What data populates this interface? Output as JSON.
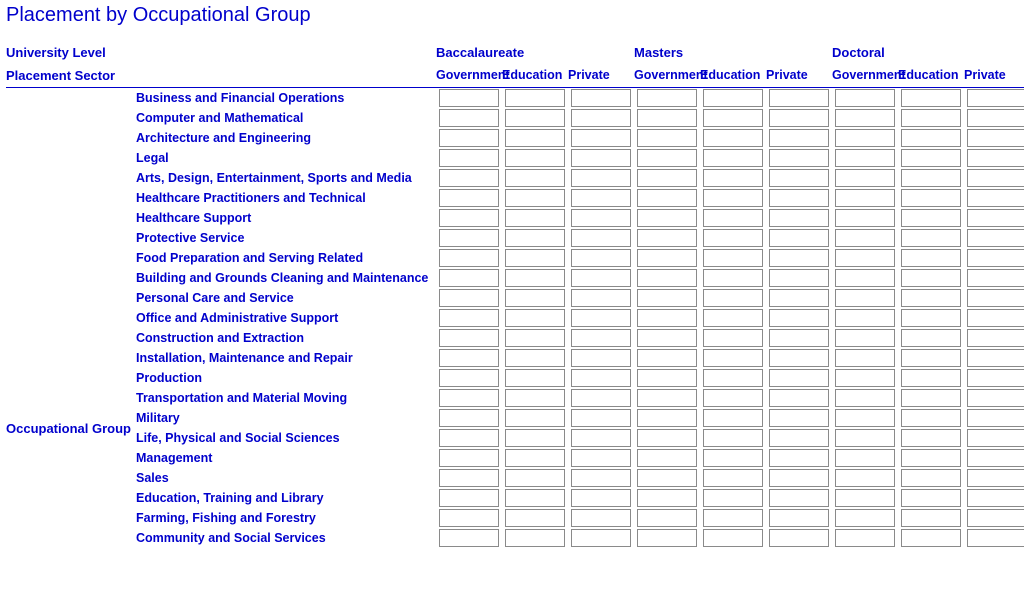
{
  "title": "Placement by Occupational Group",
  "headers": {
    "university_level": "University Level",
    "placement_sector": "Placement Sector",
    "levels": [
      "Baccalaureate",
      "Masters",
      "Doctoral"
    ],
    "sectors": [
      "Government",
      "Education",
      "Private"
    ]
  },
  "row_group_label": "Occupational Group",
  "rows": [
    "Business and Financial Operations",
    "Computer and Mathematical",
    "Architecture and Engineering",
    "Legal",
    "Arts, Design, Entertainment, Sports and Media",
    "Healthcare Practitioners and Technical",
    "Healthcare Support",
    "Protective Service",
    "Food Preparation and Serving Related",
    "Building and Grounds Cleaning and Maintenance",
    "Personal Care and Service",
    "Office and Administrative Support",
    "Construction and Extraction",
    "Installation, Maintenance and Repair",
    "Production",
    "Transportation and Material Moving",
    "Military",
    "Life, Physical and Social Sciences",
    "Management",
    "Sales",
    "Education, Training and Library",
    "Farming, Fishing and Forestry",
    "Community and Social Services"
  ],
  "values": [
    [
      "",
      "",
      "",
      "",
      "",
      "",
      "",
      "",
      ""
    ],
    [
      "",
      "",
      "",
      "",
      "",
      "",
      "",
      "",
      ""
    ],
    [
      "",
      "",
      "",
      "",
      "",
      "",
      "",
      "",
      ""
    ],
    [
      "",
      "",
      "",
      "",
      "",
      "",
      "",
      "",
      ""
    ],
    [
      "",
      "",
      "",
      "",
      "",
      "",
      "",
      "",
      ""
    ],
    [
      "",
      "",
      "",
      "",
      "",
      "",
      "",
      "",
      ""
    ],
    [
      "",
      "",
      "",
      "",
      "",
      "",
      "",
      "",
      ""
    ],
    [
      "",
      "",
      "",
      "",
      "",
      "",
      "",
      "",
      ""
    ],
    [
      "",
      "",
      "",
      "",
      "",
      "",
      "",
      "",
      ""
    ],
    [
      "",
      "",
      "",
      "",
      "",
      "",
      "",
      "",
      ""
    ],
    [
      "",
      "",
      "",
      "",
      "",
      "",
      "",
      "",
      ""
    ],
    [
      "",
      "",
      "",
      "",
      "",
      "",
      "",
      "",
      ""
    ],
    [
      "",
      "",
      "",
      "",
      "",
      "",
      "",
      "",
      ""
    ],
    [
      "",
      "",
      "",
      "",
      "",
      "",
      "",
      "",
      ""
    ],
    [
      "",
      "",
      "",
      "",
      "",
      "",
      "",
      "",
      ""
    ],
    [
      "",
      "",
      "",
      "",
      "",
      "",
      "",
      "",
      ""
    ],
    [
      "",
      "",
      "",
      "",
      "",
      "",
      "",
      "",
      ""
    ],
    [
      "",
      "",
      "",
      "",
      "",
      "",
      "",
      "",
      ""
    ],
    [
      "",
      "",
      "",
      "",
      "",
      "",
      "",
      "",
      ""
    ],
    [
      "",
      "",
      "",
      "",
      "",
      "",
      "",
      "",
      ""
    ],
    [
      "",
      "",
      "",
      "",
      "",
      "",
      "",
      "",
      ""
    ],
    [
      "",
      "",
      "",
      "",
      "",
      "",
      "",
      "",
      ""
    ],
    [
      "",
      "",
      "",
      "",
      "",
      "",
      "",
      "",
      ""
    ]
  ]
}
